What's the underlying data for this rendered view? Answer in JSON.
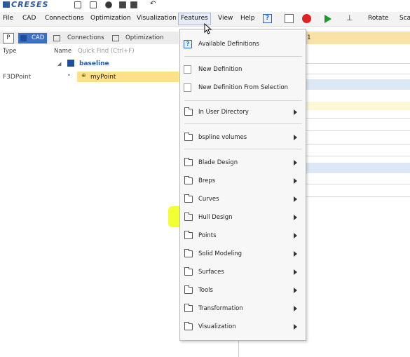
{
  "app": {
    "logo_text": "CRESES"
  },
  "menubar": {
    "items": [
      "File",
      "CAD",
      "Connections",
      "Optimization",
      "Visualization",
      "Features",
      "View",
      "Help"
    ],
    "toolbar_right": [
      "Rotate",
      "Sca"
    ]
  },
  "tabs": {
    "p_label": "P",
    "items": [
      "CAD",
      "Connections",
      "Optimization"
    ]
  },
  "table": {
    "col_type": "Type",
    "col_name": "Name",
    "search_placeholder": "Quick Find (Ctrl+F)"
  },
  "tree": {
    "group_label": "baseline",
    "row_type": "F3DPoint",
    "row_name": "myPoint"
  },
  "right_panel": {
    "header_text": "1"
  },
  "features_menu": {
    "items": [
      {
        "label": "Available Definitions",
        "icon": "help-icon",
        "submenu": false
      },
      {
        "label": "New Definition",
        "icon": "document-icon",
        "submenu": false
      },
      {
        "label": "New Definition From Selection",
        "icon": "document-icon",
        "submenu": false
      },
      {
        "label": "In User Directory",
        "icon": "folder-icon",
        "submenu": true
      },
      {
        "label": "bspline volumes",
        "icon": "folder-icon",
        "submenu": true
      },
      {
        "label": "Blade Design",
        "icon": "folder-icon",
        "submenu": true
      },
      {
        "label": "Breps",
        "icon": "folder-icon",
        "submenu": true
      },
      {
        "label": "Curves",
        "icon": "folder-icon",
        "submenu": true
      },
      {
        "label": "Hull Design",
        "icon": "folder-icon",
        "submenu": true,
        "highlighted": true
      },
      {
        "label": "Points",
        "icon": "folder-icon",
        "submenu": true
      },
      {
        "label": "Solid Modeling",
        "icon": "folder-icon",
        "submenu": true
      },
      {
        "label": "Surfaces",
        "icon": "folder-icon",
        "submenu": true
      },
      {
        "label": "Tools",
        "icon": "folder-icon",
        "submenu": true
      },
      {
        "label": "Transformation",
        "icon": "folder-icon",
        "submenu": true
      },
      {
        "label": "Visualization",
        "icon": "folder-icon",
        "submenu": true
      }
    ]
  },
  "colors": {
    "accent": "#3d6fc4",
    "highlight": "#f3ff22",
    "selected_row": "#ffe08a"
  }
}
